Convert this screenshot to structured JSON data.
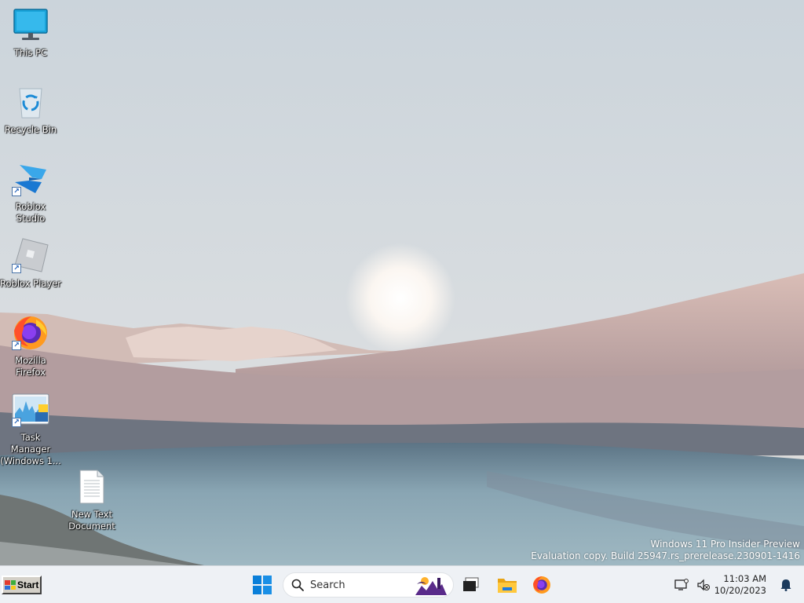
{
  "desktop": {
    "icons": [
      {
        "label": "This PC"
      },
      {
        "label": "Recycle Bin"
      },
      {
        "label": "Roblox Studio"
      },
      {
        "label": "Roblox Player"
      },
      {
        "label": "Mozilla Firefox"
      },
      {
        "label": "Task Manager (Windows 1..."
      },
      {
        "label": "New Text Document"
      }
    ]
  },
  "watermark": {
    "line1": "Windows 11 Pro Insider Preview",
    "line2": "Evaluation copy. Build 25947.rs_prerelease.230901-1416"
  },
  "taskbar": {
    "start_label": "Start",
    "search_placeholder": "Search",
    "pinned": [
      "windows-start-icon",
      "task-view-icon",
      "file-explorer-icon",
      "firefox-icon"
    ],
    "clock_time": "11:03 AM",
    "clock_date": "10/20/2023"
  },
  "colors": {
    "taskbar_bg": "#eef1f5",
    "accent": "#0078d4"
  }
}
